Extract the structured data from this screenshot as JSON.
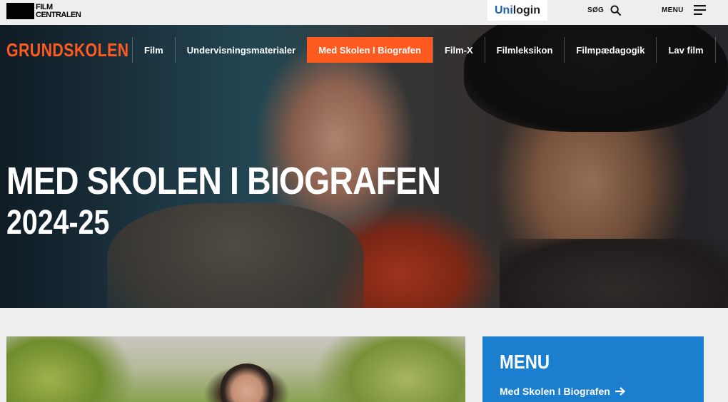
{
  "header": {
    "logo_line1": "FILM",
    "logo_line2": "CENTRALEN",
    "unilogin_part1": "Uni",
    "unilogin_part2": "login",
    "search_label": "SØG",
    "menu_label": "MENU"
  },
  "nav": {
    "brand": "GRUNDSKOLEN",
    "items": [
      {
        "label": "Film"
      },
      {
        "label": "Undervisningsmaterialer"
      },
      {
        "label": "Med Skolen I Biografen",
        "active": true
      },
      {
        "label": "Film-X"
      },
      {
        "label": "Filmleksikon"
      },
      {
        "label": "Filmpædagogik"
      },
      {
        "label": "Lav film"
      }
    ],
    "active_color": "#ff5a1f"
  },
  "hero": {
    "title": "MED SKOLEN I BIOGRAFEN",
    "year": "2024-25"
  },
  "side_menu": {
    "title": "MENU",
    "link": "Med Skolen I Biografen",
    "bg_color": "#1c7ecf"
  },
  "colors": {
    "brand_orange": "#ff5a1f",
    "unilogin_blue": "#1d5fa8",
    "menu_blue": "#1c7ecf"
  }
}
